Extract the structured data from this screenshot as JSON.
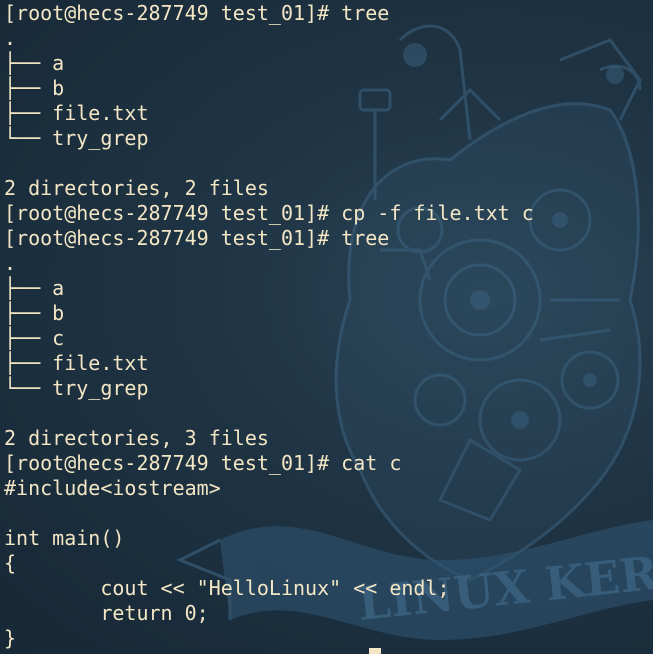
{
  "terminal": {
    "lines": [
      "[root@hecs-287749 test_01]# tree",
      ".",
      "├── a",
      "├── b",
      "├── file.txt",
      "└── try_grep",
      "",
      "2 directories, 2 files",
      "[root@hecs-287749 test_01]# cp -f file.txt c",
      "[root@hecs-287749 test_01]# tree",
      ".",
      "├── a",
      "├── b",
      "├── c",
      "├── file.txt",
      "└── try_grep",
      "",
      "2 directories, 3 files",
      "[root@hecs-287749 test_01]# cat c",
      "#include<iostream>",
      "",
      "int main()",
      "{",
      "        cout << \"HelloLinux\" << endl;",
      "        return 0;",
      "}"
    ],
    "background_watermark": "LINUX KERN",
    "colors": {
      "text": "#f2e6c4",
      "background": "#1c2d3a",
      "artwork": "#3e6684"
    }
  }
}
